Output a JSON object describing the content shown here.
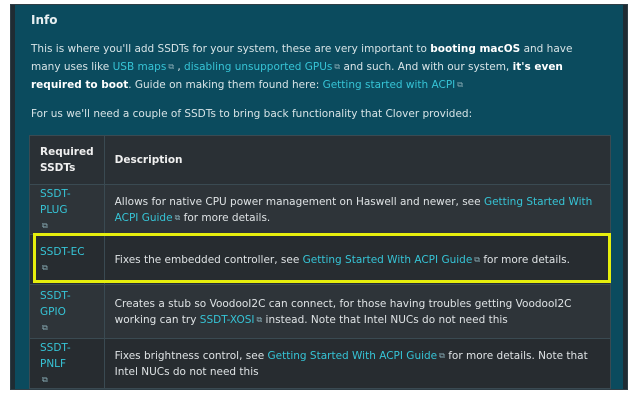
{
  "info": {
    "title": "Info",
    "p1": {
      "t1": "This is where you'll add SSDTs for your system, these are very important to ",
      "b1": "booting macOS",
      "t2": " and have many uses like ",
      "link_usb": "USB maps",
      "t3": " , ",
      "link_gpus": "disabling unsupported GPUs",
      "t4": " and such. And with our system, ",
      "b2": "it's even required to boot",
      "t5": ". Guide on making them found here: ",
      "link_acpi": "Getting started with ACPI"
    },
    "p2": "For us we'll need a couple of SSDTs to bring back functionality that Clover provided:"
  },
  "table": {
    "headers": [
      "Required SSDTs",
      "Description"
    ],
    "rows": [
      {
        "name": "SSDT-PLUG",
        "d1": "Allows for native CPU power management on Haswell and newer, see ",
        "link": "Getting Started With ACPI Guide",
        "d2": " for more details."
      },
      {
        "name": "SSDT-EC",
        "d1": "Fixes the embedded controller, see ",
        "link": "Getting Started With ACPI Guide",
        "d2": " for more details."
      },
      {
        "name": "SSDT-GPIO",
        "d1": "Creates a stub so VoodooI2C can connect, for those having troubles getting VoodooI2C working can try ",
        "link": "SSDT-XOSI",
        "d2": " instead. Note that Intel NUCs do not need this"
      },
      {
        "name": "SSDT-PNLF",
        "d1": "Fixes brightness control, see ",
        "link": "Getting Started With ACPI Guide",
        "d2": " for more details. Note that Intel NUCs do not need this"
      }
    ]
  },
  "icons": {
    "external": "external-link-icon"
  },
  "colors": {
    "panel": "#0b4b5e",
    "link": "#36c4d6",
    "highlight": "#e6ee0d"
  }
}
